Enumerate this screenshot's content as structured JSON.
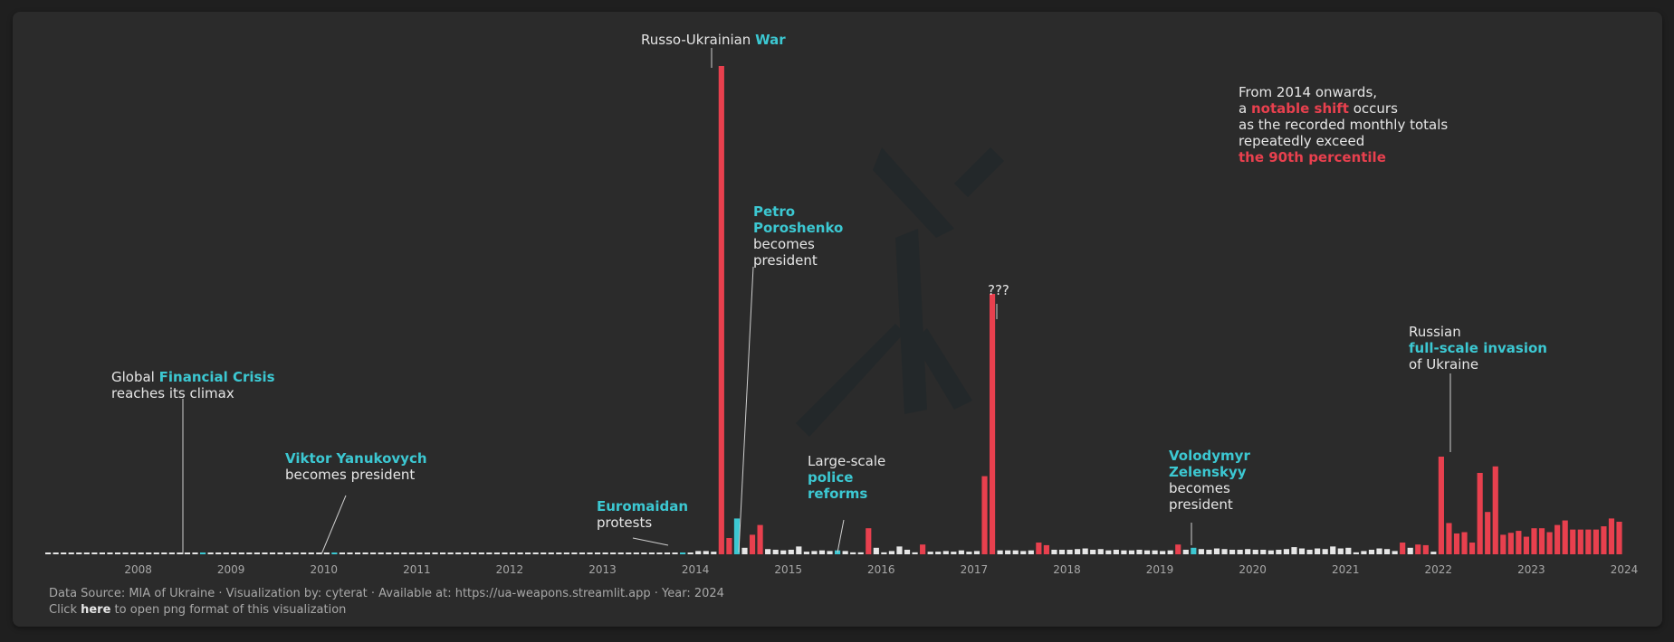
{
  "colors": {
    "background": "#2b2b2b",
    "bar_normal": "#e6e6e6",
    "bar_above_p90": "#e8404e",
    "bar_event": "#3cc8d2",
    "text": "#e6e6e6",
    "muted": "#a8a8a8",
    "accent_cyan": "#3cc8d2",
    "accent_red": "#e8404e"
  },
  "chart_data": {
    "type": "bar",
    "title": "",
    "xlabel": "",
    "ylabel": "",
    "x_ticks": [
      "2008",
      "2009",
      "2010",
      "2011",
      "2012",
      "2013",
      "2014",
      "2015",
      "2016",
      "2017",
      "2018",
      "2019",
      "2020",
      "2021",
      "2022",
      "2023",
      "2024"
    ],
    "grid": false,
    "legend": "none",
    "x_start": "2007-01",
    "x_end": "2024-05",
    "months": [
      "2007-01",
      "2007-02",
      "2007-03",
      "2007-04",
      "2007-05",
      "2007-06",
      "2007-07",
      "2007-08",
      "2007-09",
      "2007-10",
      "2007-11",
      "2007-12",
      "2008-01",
      "2008-02",
      "2008-03",
      "2008-04",
      "2008-05",
      "2008-06",
      "2008-07",
      "2008-08",
      "2008-09",
      "2008-10",
      "2008-11",
      "2008-12",
      "2009-01",
      "2009-02",
      "2009-03",
      "2009-04",
      "2009-05",
      "2009-06",
      "2009-07",
      "2009-08",
      "2009-09",
      "2009-10",
      "2009-11",
      "2009-12",
      "2010-01",
      "2010-02",
      "2010-03",
      "2010-04",
      "2010-05",
      "2010-06",
      "2010-07",
      "2010-08",
      "2010-09",
      "2010-10",
      "2010-11",
      "2010-12",
      "2011-01",
      "2011-02",
      "2011-03",
      "2011-04",
      "2011-05",
      "2011-06",
      "2011-07",
      "2011-08",
      "2011-09",
      "2011-10",
      "2011-11",
      "2011-12",
      "2012-01",
      "2012-02",
      "2012-03",
      "2012-04",
      "2012-05",
      "2012-06",
      "2012-07",
      "2012-08",
      "2012-09",
      "2012-10",
      "2012-11",
      "2012-12",
      "2013-01",
      "2013-02",
      "2013-03",
      "2013-04",
      "2013-05",
      "2013-06",
      "2013-07",
      "2013-08",
      "2013-09",
      "2013-10",
      "2013-11",
      "2013-12",
      "2014-01",
      "2014-02",
      "2014-03",
      "2014-04",
      "2014-05",
      "2014-06",
      "2014-07",
      "2014-08",
      "2014-09",
      "2014-10",
      "2014-11",
      "2014-12",
      "2015-01",
      "2015-02",
      "2015-03",
      "2015-04",
      "2015-05",
      "2015-06",
      "2015-07",
      "2015-08",
      "2015-09",
      "2015-10",
      "2015-11",
      "2015-12",
      "2016-01",
      "2016-02",
      "2016-03",
      "2016-04",
      "2016-05",
      "2016-06",
      "2016-07",
      "2016-08",
      "2016-09",
      "2016-10",
      "2016-11",
      "2016-12",
      "2017-01",
      "2017-02",
      "2017-03",
      "2017-04",
      "2017-05",
      "2017-06",
      "2017-07",
      "2017-08",
      "2017-09",
      "2017-10",
      "2017-11",
      "2017-12",
      "2018-01",
      "2018-02",
      "2018-03",
      "2018-04",
      "2018-05",
      "2018-06",
      "2018-07",
      "2018-08",
      "2018-09",
      "2018-10",
      "2018-11",
      "2018-12",
      "2019-01",
      "2019-02",
      "2019-03",
      "2019-04",
      "2019-05",
      "2019-06",
      "2019-07",
      "2019-08",
      "2019-09",
      "2019-10",
      "2019-11",
      "2019-12",
      "2020-01",
      "2020-02",
      "2020-03",
      "2020-04",
      "2020-05",
      "2020-06",
      "2020-07",
      "2020-08",
      "2020-09",
      "2020-10",
      "2020-11",
      "2020-12",
      "2021-01",
      "2021-02",
      "2021-03",
      "2021-04",
      "2021-05",
      "2021-06",
      "2021-07",
      "2021-08",
      "2021-09",
      "2021-10",
      "2021-11",
      "2021-12",
      "2022-01",
      "2022-02",
      "2022-03",
      "2022-04",
      "2022-05",
      "2022-06",
      "2022-07",
      "2022-08",
      "2022-09",
      "2022-10",
      "2022-11",
      "2022-12",
      "2023-01",
      "2023-02",
      "2023-03",
      "2023-04",
      "2023-05",
      "2023-06",
      "2023-07",
      "2023-08",
      "2023-09",
      "2023-10",
      "2023-11",
      "2023-12",
      "2024-01",
      "2024-02",
      "2024-03",
      "2024-04"
    ],
    "values": [
      2,
      2,
      2,
      2,
      2,
      2,
      2,
      2,
      2,
      2,
      2,
      2,
      2,
      2,
      2,
      2,
      2,
      2,
      2,
      2,
      2,
      2,
      2,
      2,
      2,
      2,
      2,
      2,
      2,
      2,
      2,
      2,
      2,
      2,
      2,
      2,
      2,
      2,
      2,
      2,
      2,
      2,
      2,
      2,
      2,
      2,
      2,
      2,
      2,
      2,
      2,
      2,
      2,
      2,
      2,
      2,
      2,
      2,
      2,
      2,
      2,
      2,
      2,
      2,
      2,
      2,
      2,
      2,
      2,
      2,
      2,
      2,
      2,
      2,
      2,
      2,
      2,
      2,
      2,
      2,
      2,
      2,
      2,
      2,
      5,
      5,
      4,
      750,
      25,
      55,
      10,
      30,
      45,
      8,
      7,
      6,
      7,
      12,
      4,
      5,
      6,
      5,
      6,
      5,
      3,
      3,
      40,
      10,
      3,
      5,
      12,
      7,
      3,
      15,
      4,
      4,
      5,
      4,
      6,
      4,
      5,
      120,
      400,
      6,
      6,
      6,
      5,
      6,
      18,
      14,
      7,
      7,
      7,
      8,
      9,
      7,
      8,
      6,
      7,
      6,
      6,
      7,
      6,
      6,
      5,
      6,
      15,
      7,
      10,
      8,
      7,
      9,
      8,
      7,
      7,
      8,
      7,
      7,
      6,
      7,
      8,
      11,
      9,
      7,
      9,
      8,
      12,
      9,
      10,
      3,
      5,
      7,
      9,
      8,
      5,
      18,
      10,
      15,
      14,
      4,
      150,
      48,
      32,
      34,
      18,
      125,
      65,
      135,
      30,
      33,
      36,
      27,
      40,
      40,
      34,
      45,
      52,
      38,
      38,
      38,
      38,
      43,
      55,
      50
    ],
    "categories_of_bars": {
      "above_p90_from": "2014",
      "event_months": [
        "2008-09",
        "2010-02",
        "2013-11",
        "2014-06",
        "2015-07",
        "2019-05"
      ]
    }
  },
  "annotations": {
    "war": {
      "pre": "Russo-Ukrainian ",
      "hl": "War"
    },
    "mystery": {
      "text": "???"
    },
    "notable": {
      "l1": "From 2014 onwards,",
      "l2_pre": "a ",
      "l2_hl": "notable shift",
      "l2_post": " occurs",
      "l3": "as the recorded monthly totals",
      "l4": "repeatedly exceed",
      "l5": "the 90th percentile"
    },
    "poroshenko": {
      "hl1": "Petro",
      "hl2": "Poroshenko",
      "l3": "becomes",
      "l4": "president"
    },
    "invasion": {
      "l1": "Russian",
      "hl": "full-scale invasion",
      "l3": "of Ukraine"
    },
    "crisis": {
      "pre": "Global ",
      "hl": "Financial Crisis",
      "l2": "reaches its climax"
    },
    "yanukovych": {
      "hl": "Viktor Yanukovych",
      "l2": "becomes president"
    },
    "police": {
      "l1": "Large-scale",
      "hl1": "police",
      "hl2": "reforms"
    },
    "zelenskyy": {
      "hl1": "Volodymyr",
      "hl2": "Zelenskyy",
      "l3": "becomes",
      "l4": "president"
    },
    "euromaidan": {
      "hl": "Euromaidan",
      "l2": "protests"
    }
  },
  "footer": {
    "line1": "Data Source: MIA of Ukraine · Visualization by: cyterat · Available at: https://ua-weapons.streamlit.app · Year: 2024",
    "line2_pre": "Click ",
    "link": "here",
    "line2_post": " to open png format of this visualization"
  }
}
